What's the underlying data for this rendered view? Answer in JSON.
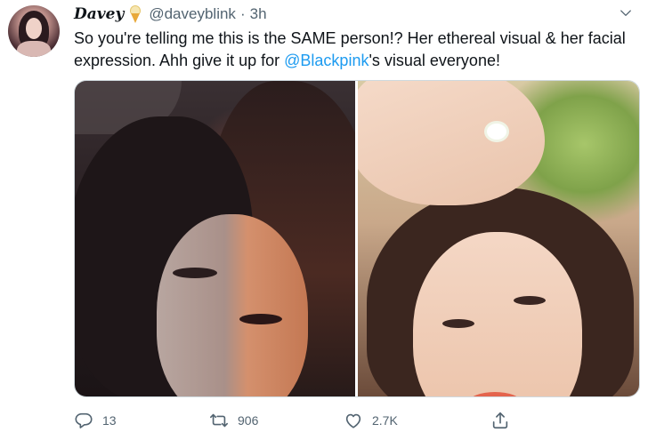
{
  "tweet": {
    "display_name": "Davey",
    "handle": "@daveyblink",
    "separator": "·",
    "timestamp": "3h",
    "text_before": "So you're telling me this is the SAME person!? Her ethereal visual & her facial expression. Ahh give it up for ",
    "mention": "@Blackpink",
    "text_after": "'s visual everyone!",
    "avatar_icon": "profile-photo",
    "name_emoji": "ice-cream-icon",
    "menu_icon": "chevron-down-icon"
  },
  "media": {
    "photos": [
      "photo-left",
      "photo-right"
    ]
  },
  "actions": {
    "reply_count": "13",
    "retweet_count": "906",
    "like_count": "2.7K",
    "icons": [
      "reply-icon",
      "retweet-icon",
      "like-icon",
      "share-icon"
    ]
  },
  "colors": {
    "accent": "#1d9bf0",
    "secondary_text": "#536471",
    "icon": "#536471"
  }
}
